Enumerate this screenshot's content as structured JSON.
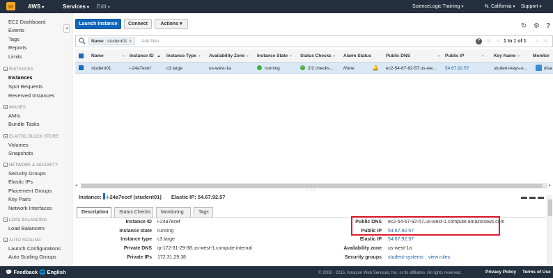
{
  "topnav": {
    "brand": "AWS",
    "services": "Services",
    "edit": "Edit",
    "account": "ScienceLogic Training",
    "region": "N. California",
    "support": "Support"
  },
  "sidebar": {
    "ec2_dashboard": "EC2 Dashboard",
    "events": "Events",
    "tags": "Tags",
    "reports": "Reports",
    "limits": "Limits",
    "sections": [
      {
        "title": "INSTANCES",
        "items": [
          "Instances",
          "Spot Requests",
          "Reserved Instances"
        ]
      },
      {
        "title": "IMAGES",
        "items": [
          "AMIs",
          "Bundle Tasks"
        ]
      },
      {
        "title": "ELASTIC BLOCK STORE",
        "items": [
          "Volumes",
          "Snapshots"
        ]
      },
      {
        "title": "NETWORK & SECURITY",
        "items": [
          "Security Groups",
          "Elastic IPs",
          "Placement Groups",
          "Key Pairs",
          "Network Interfaces"
        ]
      },
      {
        "title": "LOAD BALANCING",
        "items": [
          "Load Balancers"
        ]
      },
      {
        "title": "AUTO SCALING",
        "items": [
          "Launch Configurations",
          "Auto Scaling Groups"
        ]
      }
    ],
    "active_item": "Instances"
  },
  "toolbar": {
    "launch": "Launch Instance",
    "connect": "Connect",
    "actions": "Actions"
  },
  "filter": {
    "chip_key": "Name",
    "chip_value": "student01",
    "placeholder": "Add filter",
    "pager_text": "1 to 1 of 1"
  },
  "table": {
    "columns": [
      "Name",
      "Instance ID",
      "Instance Type",
      "Availability Zone",
      "Instance State",
      "Status Checks",
      "Alarm Status",
      "Public DNS",
      "Public IP",
      "Key Name",
      "Monitor"
    ],
    "rows": [
      {
        "name": "student01",
        "instance_id": "i-24a7ecef",
        "instance_type": "c3.large",
        "availability_zone": "us-west-1a",
        "state": "running",
        "status_checks": "2/2 checks...",
        "alarm_status": "None",
        "public_dns": "ec2-54-67-92-57.us-we...",
        "public_ip": "54.67.92.57",
        "key_name": "student-keys-u...",
        "monitoring": "disa"
      }
    ]
  },
  "details": {
    "instance_label": "Instance:",
    "instance_id": "i-24a7ecef (student01)",
    "elastic_ip_label": "Elastic IP: 54.67.92.57",
    "tabs": [
      "Description",
      "Status Checks",
      "Monitoring",
      "Tags"
    ],
    "left": [
      {
        "label": "Instance ID",
        "value": "i-24a7ecef"
      },
      {
        "label": "Instance state",
        "value": "running"
      },
      {
        "label": "Instance type",
        "value": "c3.large"
      },
      {
        "label": "Private DNS",
        "value": "ip-172-31-29-38.us-west-1.compute.internal"
      },
      {
        "label": "Private IPs",
        "value": "172.31.29.38"
      }
    ],
    "right": [
      {
        "label": "Public DNS",
        "value": "ec2-54-67-92-57.us-west-1.compute.amazonaws.com"
      },
      {
        "label": "Public IP",
        "value": "54.67.92.57"
      },
      {
        "label": "Elastic IP",
        "value": "54.67.92.57"
      },
      {
        "label": "Availability zone",
        "value": "us-west-1a"
      },
      {
        "label": "Security groups",
        "value": "student-systems",
        "extra": "view rules"
      }
    ]
  },
  "footer": {
    "feedback": "Feedback",
    "language": "English",
    "copyright": "© 2008 - 2015, Amazon Web Services, Inc. or its affiliates. All rights reserved.",
    "privacy": "Privacy Policy",
    "terms": "Terms of Use"
  },
  "colors": {
    "nav_bg": "#232f3e",
    "primary": "#1166bb",
    "selected_row": "#dbe9f6",
    "highlight_box": "#e0192c",
    "running": "#3cb043"
  }
}
